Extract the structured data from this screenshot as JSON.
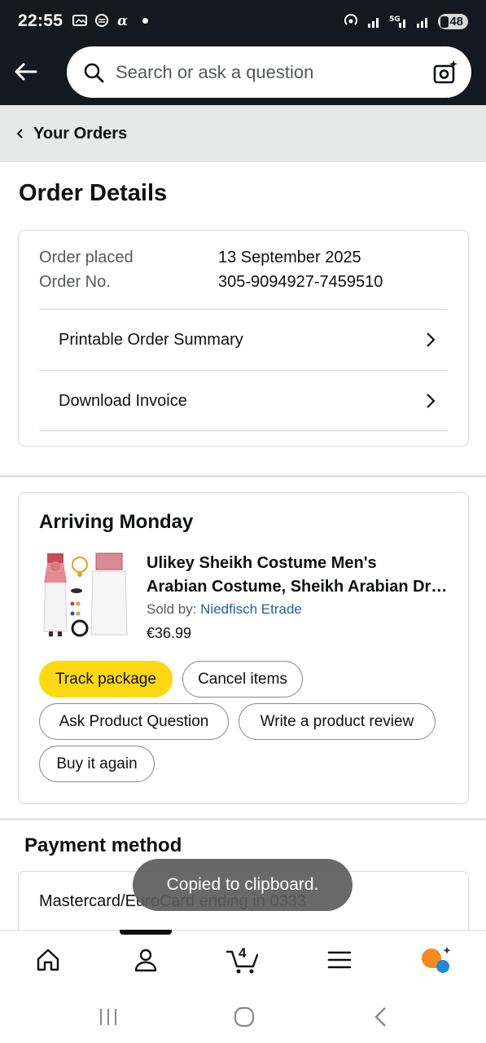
{
  "status_bar": {
    "time": "22:55",
    "battery": "48"
  },
  "search": {
    "placeholder": "Search or ask a question"
  },
  "breadcrumb": {
    "label": "Your Orders"
  },
  "page": {
    "title": "Order Details"
  },
  "order": {
    "placed_label": "Order placed",
    "placed_value": "13 September 2025",
    "number_label": "Order No.",
    "number_value": "305-9094927-7459510",
    "links": [
      {
        "label": "Printable Order Summary"
      },
      {
        "label": "Download Invoice"
      }
    ]
  },
  "shipment": {
    "status": "Arriving Monday",
    "product": {
      "title_line1": "Ulikey Sheikh Costume Men's",
      "title_line2": "Arabian Costume, Sheikh Arabian Dress",
      "sold_by_label": "Sold by: ",
      "seller": "Niedfisch Etrade",
      "price": "€36.99"
    },
    "actions": {
      "track": "Track package",
      "cancel": "Cancel items",
      "ask": "Ask Product Question",
      "review": "Write a product review",
      "buy_again": "Buy it again"
    }
  },
  "payment": {
    "title": "Payment method",
    "method": "Mastercard/EuroCard ending in 0333"
  },
  "toast": {
    "message": "Copied to clipboard."
  },
  "bottom_nav": {
    "cart_count": "4",
    "items": [
      {
        "icon": "home-icon"
      },
      {
        "icon": "account-icon",
        "active": true
      },
      {
        "icon": "cart-icon"
      },
      {
        "icon": "menu-icon"
      },
      {
        "icon": "rufus-icon"
      }
    ]
  },
  "colors": {
    "header_bg": "#131921",
    "primary_button": "#ffd814",
    "link": "#2162a1",
    "breadcrumb_bg": "#e7e9e9"
  }
}
